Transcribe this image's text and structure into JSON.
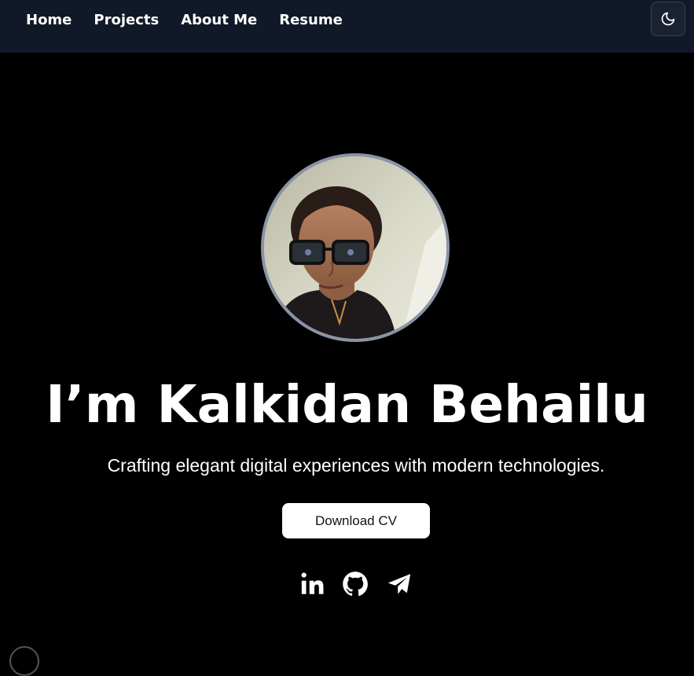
{
  "nav": {
    "links": [
      {
        "label": "Home"
      },
      {
        "label": "Projects"
      },
      {
        "label": "About Me"
      },
      {
        "label": "Resume"
      }
    ],
    "theme_icon": "moon-icon"
  },
  "hero": {
    "avatar_icon": "profile-photo",
    "title": "I’m Kalkidan Behailu",
    "subtitle": "Crafting elegant digital experiences with modern technologies.",
    "download_label": "Download CV"
  },
  "social": [
    {
      "icon": "linkedin-icon"
    },
    {
      "icon": "github-icon"
    },
    {
      "icon": "telegram-icon"
    }
  ],
  "colors": {
    "nav_bg": "#111827",
    "page_bg": "#000000",
    "avatar_border": "#8a94a6",
    "button_bg": "#ffffff",
    "text": "#ffffff"
  }
}
